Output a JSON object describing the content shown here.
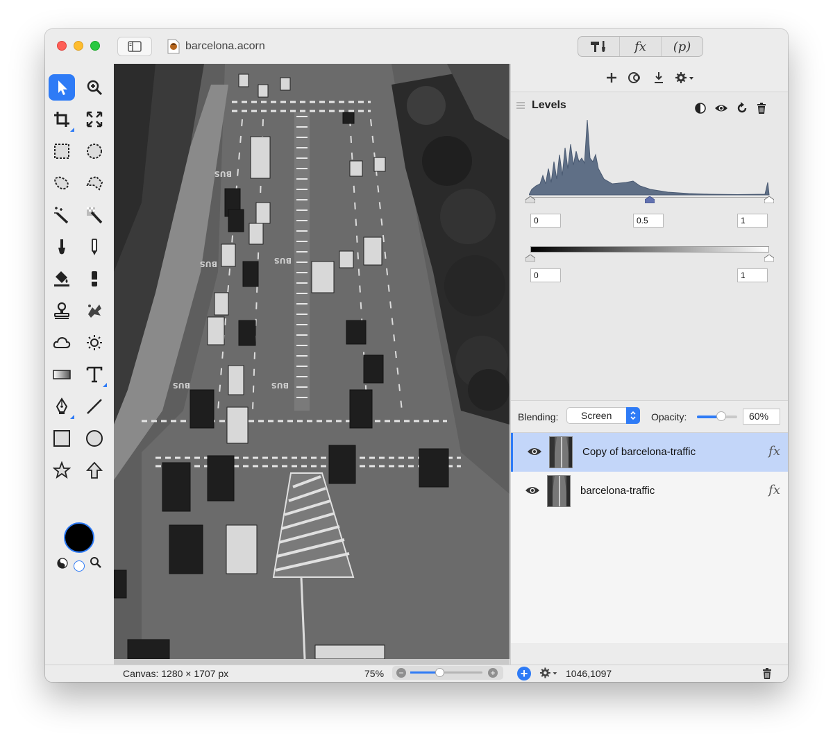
{
  "window": {
    "title": "barcelona.acorn",
    "toolbar_segments": [
      {
        "name": "tools-icon",
        "label": "🔨🖌"
      },
      {
        "name": "fx-icon",
        "label": "fx"
      },
      {
        "name": "p-icon",
        "label": "(p)"
      }
    ]
  },
  "tools": [
    {
      "name": "move-tool-icon",
      "active": true
    },
    {
      "name": "zoom-tool-icon"
    },
    {
      "name": "crop-tool-icon"
    },
    {
      "name": "transform-tool-icon"
    },
    {
      "name": "rect-select-tool-icon"
    },
    {
      "name": "ellipse-select-tool-icon"
    },
    {
      "name": "lasso-tool-icon"
    },
    {
      "name": "polygon-lasso-tool-icon"
    },
    {
      "name": "magic-wand-tool-icon"
    },
    {
      "name": "instant-alpha-tool-icon"
    },
    {
      "name": "brush-tool-icon"
    },
    {
      "name": "pencil-tool-icon"
    },
    {
      "name": "paint-bucket-tool-icon"
    },
    {
      "name": "eraser-tool-icon"
    },
    {
      "name": "clone-stamp-tool-icon"
    },
    {
      "name": "smudge-tool-icon"
    },
    {
      "name": "cloud-tool-icon"
    },
    {
      "name": "sun-tool-icon"
    },
    {
      "name": "gradient-tool-icon"
    },
    {
      "name": "text-tool-icon"
    },
    {
      "name": "pen-tool-icon"
    },
    {
      "name": "line-tool-icon"
    },
    {
      "name": "rectangle-tool-icon"
    },
    {
      "name": "oval-tool-icon"
    },
    {
      "name": "star-tool-icon"
    },
    {
      "name": "arrow-tool-icon"
    }
  ],
  "colors": {
    "foreground": "#000000",
    "background": "#ffffff",
    "accent": "#2e7bf6",
    "selected_row": "#c3d6f9"
  },
  "filter_toolbar": {
    "icons": [
      "add-filter-icon",
      "filter-preview-icon",
      "download-icon",
      "gear-menu-icon"
    ]
  },
  "levels": {
    "title": "Levels",
    "input_black": "0",
    "input_gamma": "0.5",
    "input_white": "1",
    "output_black": "0",
    "output_white": "1",
    "gamma_position": 0.5
  },
  "blending": {
    "label": "Blending:",
    "mode": "Screen",
    "opacity_label": "Opacity:",
    "opacity_value": "60%",
    "opacity_fraction": 0.6
  },
  "layers": [
    {
      "name": "Copy of barcelona-traffic",
      "selected": true,
      "fx": "fx"
    },
    {
      "name": "barcelona-traffic",
      "selected": false,
      "fx": "fx"
    }
  ],
  "status": {
    "canvas_size": "Canvas: 1280 × 1707 px",
    "zoom": "75%",
    "zoom_fraction": 0.4,
    "coordinates": "1046,1097"
  }
}
